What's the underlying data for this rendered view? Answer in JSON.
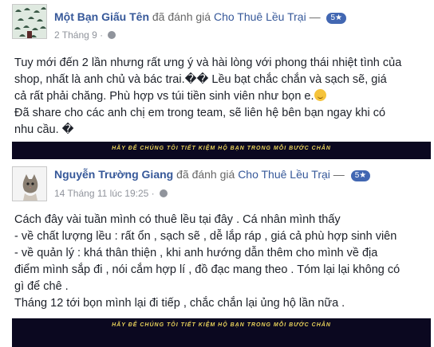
{
  "reviews": [
    {
      "author": "Một Bạn Giấu Tên",
      "verb": "đã đánh giá",
      "page_name": "Cho Thuê Lều Trại",
      "dash": "—",
      "rating": "5★",
      "date": "2 Tháng 9 ·",
      "lines": [
        "Tuy mới đến 2 lần nhưng rất ưng ý và hài lòng với phong thái nhiệt tình của",
        "shop, nhất là anh chủ và bác trai.�� Lều bạt chắc chắn và sạch sẽ, giá",
        "cả rất phải chăng. Phù hợp vs túi tiền sinh viên như bọn e.",
        "Đã share cho các anh chị em trong team, sẽ liên hệ bên bạn ngay khi có",
        "nhu cầu. �"
      ],
      "banner": "HÃY ĐỂ CHÚNG TÔI TIẾT KIỆM HỘ BẠN TRONG MỖI BƯỚC CHÂN"
    },
    {
      "author": "Nguyễn Trường Giang",
      "verb": "đã đánh giá",
      "page_name": "Cho Thuê Lều Trại",
      "dash": "—",
      "rating": "5★",
      "date": "14 Tháng 11 lúc 19:25 ·",
      "lines": [
        "Cách đây vài tuần mình có thuê lều tại đây . Cá nhân mình thấy",
        "- về chất lượng lều : rất ổn , sạch sẽ , dễ lắp ráp , giá cả phù hợp sinh viên",
        "- về quản lý : khá thân thiện , khi anh hướng dẫn thêm cho mình về địa",
        "điểm mình sắp đi , nói cắm hợp lí , đồ đạc mang theo . Tóm lại lại không có",
        "gì để chê .",
        "Tháng 12 tới bọn mình lại đi tiếp , chắc chắn lại ủng hộ lần nữa ."
      ],
      "banner": "HÃY ĐỂ CHÚNG TÔI TIẾT KIỆM HỘ BẠN TRONG MỖI BƯỚC CHÂN"
    }
  ]
}
